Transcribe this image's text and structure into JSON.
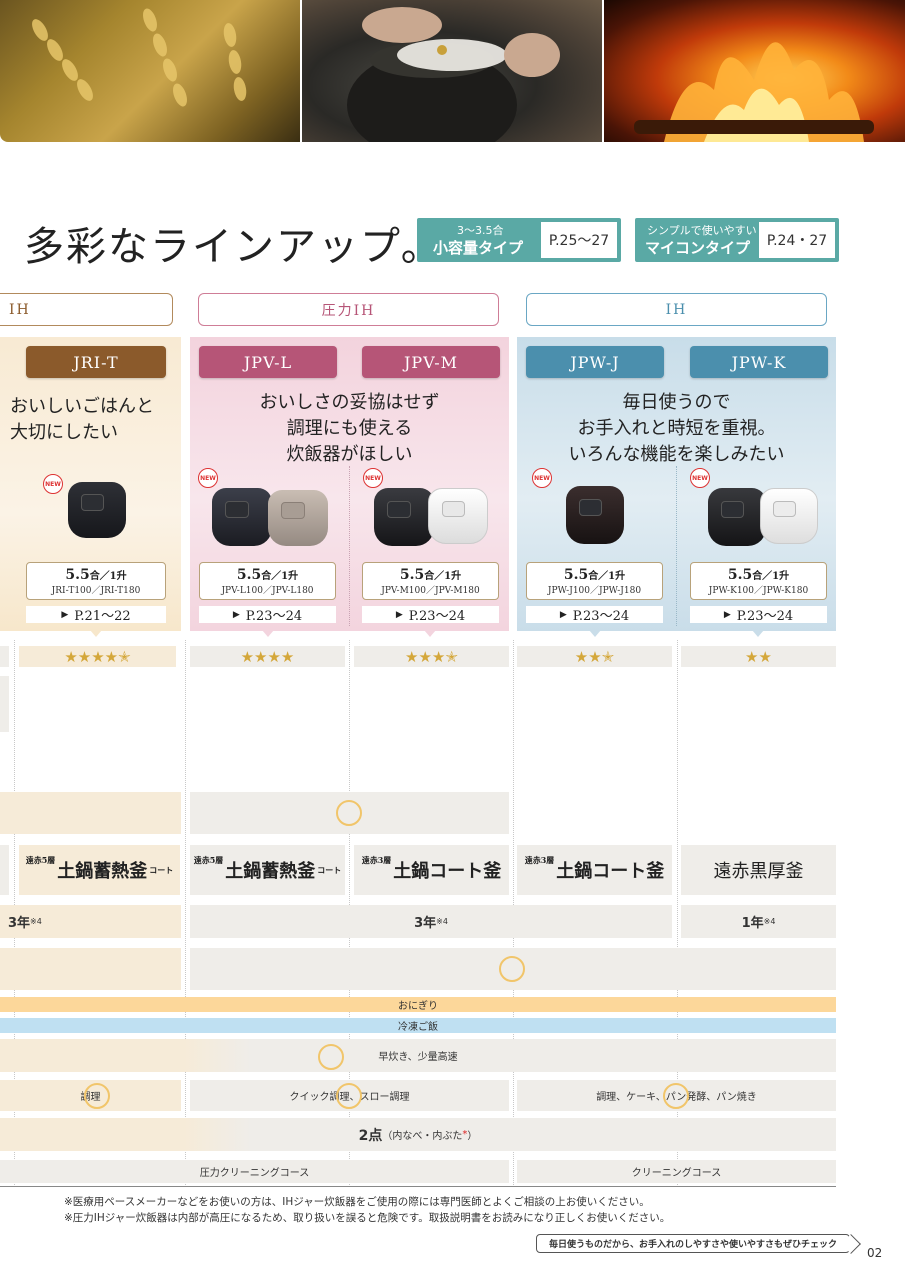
{
  "title": "多彩なラインアップ。",
  "tags": [
    {
      "small": "3〜3.5合",
      "big": "小容量タイプ",
      "page": "P.25〜27"
    },
    {
      "small": "シンプルで使いやすい",
      "big": "マイコンタイプ",
      "page": "P.24・27"
    }
  ],
  "groups": {
    "ih_left": "IH",
    "pressure_ih": "圧力IH",
    "ih_right": "IH"
  },
  "colors": {
    "brown": "#8b5a2b",
    "pink": "#b65577",
    "blue": "#4b8fad",
    "gold": "#d4a73a",
    "orange_circle": "#f1c56a",
    "onigiri_bar": "#fcd79a",
    "frozen_bar": "#bfe0f2"
  },
  "models": [
    {
      "name": "JRI-T",
      "capacity": "5.5",
      "capacity_unit": "合／1升",
      "numbers": "JRI-T100／JRI-T180",
      "page": "P.21〜22",
      "stars": "★★★★✭",
      "new": "NEW"
    },
    {
      "name": "JPV-L",
      "capacity": "5.5",
      "capacity_unit": "合／1升",
      "numbers": "JPV-L100／JPV-L180",
      "page": "P.23〜24",
      "stars": "★★★★",
      "new": "NEW"
    },
    {
      "name": "JPV-M",
      "capacity": "5.5",
      "capacity_unit": "合／1升",
      "numbers": "JPV-M100／JPV-M180",
      "page": "P.23〜24",
      "stars": "★★★✭",
      "new": "NEW"
    },
    {
      "name": "JPW-J",
      "capacity": "5.5",
      "capacity_unit": "合／1升",
      "numbers": "JPW-J100／JPW-J180",
      "page": "P.23〜24",
      "stars": "★★✭",
      "new": "NEW"
    },
    {
      "name": "JPW-K",
      "capacity": "5.5",
      "capacity_unit": "合／1升",
      "numbers": "JPW-K100／JPW-K180",
      "page": "P.23〜24",
      "stars": "★★",
      "new": "NEW"
    }
  ],
  "taglines": {
    "jri_line1": "おいしいごはんと",
    "jri_line2": "大切にしたい",
    "pressure_line1": "おいしさの妥協はせず",
    "pressure_line2": "調理にも使える",
    "pressure_line3": "炊飯器がほしい",
    "ih_line1": "毎日使うので",
    "ih_line2": "お手入れと時短を重視。",
    "ih_line3": "いろんな機能を楽しみたい"
  },
  "pots": [
    {
      "sup": "遠赤5層",
      "name": "土鍋蓄熱釜",
      "sub": "コート"
    },
    {
      "sup": "遠赤5層",
      "name": "土鍋蓄熱釜",
      "sub": "コート"
    },
    {
      "sup": "遠赤3層",
      "name": "土鍋コート釜",
      "sub": ""
    },
    {
      "sup": "遠赤3層",
      "name": "土鍋コート釜",
      "sub": ""
    },
    {
      "sup": "",
      "name": "遠赤黒厚釜",
      "sub": ""
    }
  ],
  "warranty": {
    "left_value": "3年",
    "left_note": "※4",
    "mid_value": "3年",
    "mid_note": "※4",
    "right_value": "1年",
    "right_note": "※4"
  },
  "features": {
    "onigiri": "おにぎり",
    "frozen": "冷凍ご飯",
    "quick": "早炊き、少量高速",
    "cook_jri": "調理",
    "cook_pressure": "クイック調理、スロー調理",
    "cook_ih": "調理、ケーキ、パン発酵、パン焼き",
    "parts_count": "2点",
    "parts_detail": "（内なべ・内ぶた",
    "parts_mark": "*",
    "parts_close": "）",
    "clean_pressure": "圧力クリーニングコース",
    "clean_ih": "クリーニングコース"
  },
  "footnotes": [
    "※医療用ペースメーカーなどをお使いの方は、IHジャー炊飯器をご使用の際には専門医師とよくご相談の上お使いください。",
    "※圧力IHジャー炊飯器は内部が高圧になるため、取り扱いを誤ると危険です。取扱説明書をお読みになり正しくお使いください。"
  ],
  "bottom_link": "毎日使うものだから、お手入れのしやすさや使いやすさもぜひチェック",
  "page_number": "02"
}
